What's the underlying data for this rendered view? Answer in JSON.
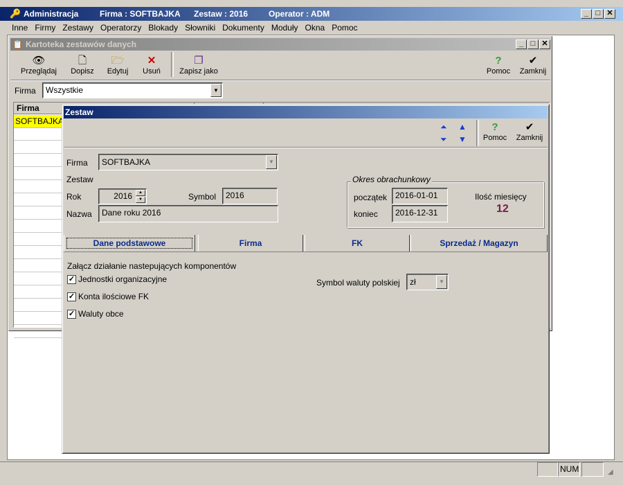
{
  "app_title": "Administracja",
  "header_firma": "Firma : SOFTBAJKA",
  "header_zestaw": "Zestaw : 2016",
  "header_operator": "Operator : ADM",
  "menu": [
    "Inne",
    "Firmy",
    "Zestawy",
    "Operatorzy",
    "Blokady",
    "Słowniki",
    "Dokumenty",
    "Moduły",
    "Okna",
    "Pomoc"
  ],
  "kartoteka": {
    "title": "Kartoteka zestawów danych",
    "toolbar": {
      "view": "Przeglądaj",
      "add": "Dopisz",
      "edit": "Edytuj",
      "delete": "Usuń",
      "save_as": "Zapisz jako",
      "help": "Pomoc",
      "close": "Zamknij"
    },
    "firma_label": "Firma",
    "firma_value": "Wszystkie",
    "grid_header": "Firma",
    "grid_rows": [
      "SOFTBAJKA"
    ]
  },
  "zestaw": {
    "title": "Zestaw",
    "help": "Pomoc",
    "close": "Zamknij",
    "firma_label": "Firma",
    "firma_value": "SOFTBAJKA",
    "section_label": "Zestaw",
    "rok_label": "Rok",
    "rok_value": "2016",
    "symbol_label": "Symbol",
    "symbol_value": "2016",
    "nazwa_label": "Nazwa",
    "nazwa_value": "Dane roku 2016",
    "okres_title": "Okres obrachunkowy",
    "poczatek_label": "początek",
    "poczatek_value": "2016-01-01",
    "koniec_label": "koniec",
    "koniec_value": "2016-12-31",
    "ilosc_label": "Ilość miesięcy",
    "ilosc_value": "12",
    "tabs": [
      "Dane podstawowe",
      "Firma",
      "FK",
      "Sprzedaż / Magazyn"
    ],
    "components_label": "Załącz działanie nastepujących komponentów",
    "checkboxes": [
      {
        "label": "Jednostki organizacyjne",
        "checked": true
      },
      {
        "label": "Konta ilościowe FK",
        "checked": true
      },
      {
        "label": "Waluty obce",
        "checked": true
      }
    ],
    "currency_label": "Symbol waluty polskiej",
    "currency_value": "zł"
  },
  "status": {
    "num": "NUM"
  },
  "colors": {
    "title_active": "#0a246a",
    "highlight_row": "#ffff00",
    "months_value": "#7a1b4a",
    "tab_text": "#0a2a8a"
  }
}
